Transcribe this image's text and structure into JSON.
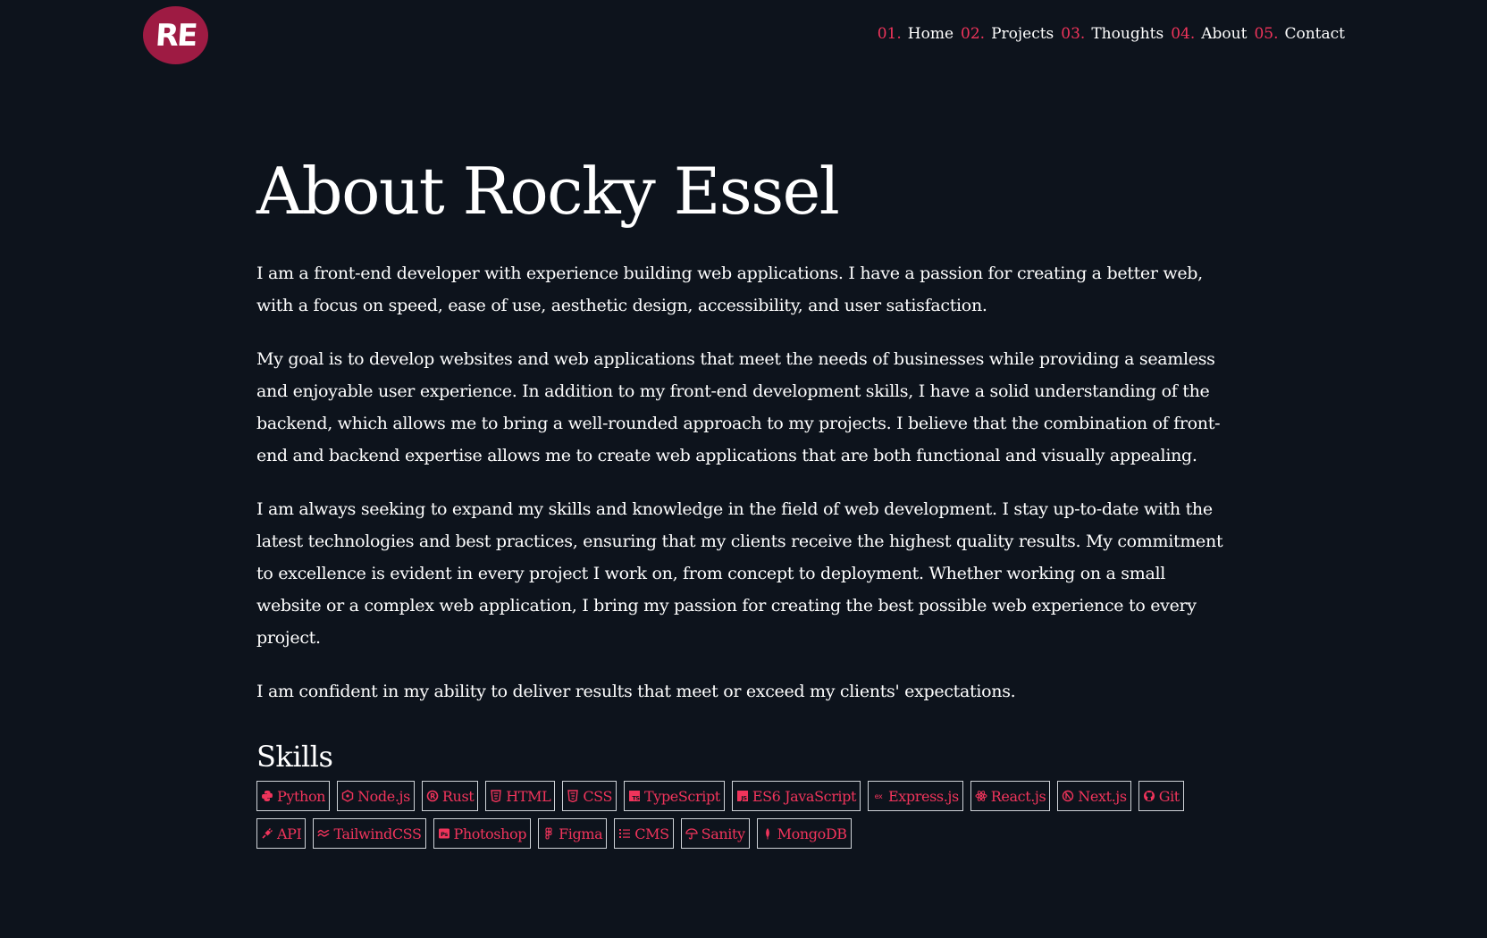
{
  "logo": {
    "text": "RE"
  },
  "nav": [
    {
      "num": "01.",
      "label": "Home"
    },
    {
      "num": "02.",
      "label": "Projects"
    },
    {
      "num": "03.",
      "label": "Thoughts"
    },
    {
      "num": "04.",
      "label": "About"
    },
    {
      "num": "05.",
      "label": "Contact"
    }
  ],
  "main": {
    "title": "About Rocky Essel",
    "paragraphs": [
      "I am a front-end developer with experience building web applications. I have a passion for creating a better web, with a focus on speed, ease of use, aesthetic design, accessibility, and user satisfaction.",
      "My goal is to develop websites and web applications that meet the needs of businesses while providing a seamless and enjoyable user experience. In addition to my front-end development skills, I have a solid understanding of the backend, which allows me to bring a well-rounded approach to my projects. I believe that the combination of front-end and backend expertise allows me to create web applications that are both functional and visually appealing.",
      "I am always seeking to expand my skills and knowledge in the field of web development. I stay up-to-date with the latest technologies and best practices, ensuring that my clients receive the highest quality results. My commitment to excellence is evident in every project I work on, from concept to deployment. Whether working on a small website or a complex web application, I bring my passion for creating the best possible web experience to every project.",
      "I am confident in my ability to deliver results that meet or exceed my clients' expectations."
    ],
    "skills_heading": "Skills",
    "skills": [
      {
        "label": "Python",
        "icon": "python-icon"
      },
      {
        "label": "Node.js",
        "icon": "nodejs-icon"
      },
      {
        "label": "Rust",
        "icon": "rust-icon"
      },
      {
        "label": "HTML",
        "icon": "html5-icon"
      },
      {
        "label": "CSS",
        "icon": "css3-icon"
      },
      {
        "label": "TypeScript",
        "icon": "typescript-icon"
      },
      {
        "label": "ES6 JavaScript",
        "icon": "javascript-icon"
      },
      {
        "label": "Express.js",
        "icon": "express-icon"
      },
      {
        "label": "React.js",
        "icon": "react-icon"
      },
      {
        "label": "Next.js",
        "icon": "nextjs-icon"
      },
      {
        "label": "Git",
        "icon": "github-icon"
      },
      {
        "label": "API",
        "icon": "plug-icon"
      },
      {
        "label": "TailwindCSS",
        "icon": "tailwind-icon"
      },
      {
        "label": "Photoshop",
        "icon": "photoshop-icon"
      },
      {
        "label": "Figma",
        "icon": "figma-icon"
      },
      {
        "label": "CMS",
        "icon": "list-icon"
      },
      {
        "label": "Sanity",
        "icon": "umbrella-icon"
      },
      {
        "label": "MongoDB",
        "icon": "leaf-icon"
      }
    ]
  },
  "colors": {
    "background": "#0d131c",
    "accent": "#f0345b",
    "logo_bg": "#9e1b43",
    "text": "#ffffff",
    "skill_border": "#cfd3d8"
  }
}
